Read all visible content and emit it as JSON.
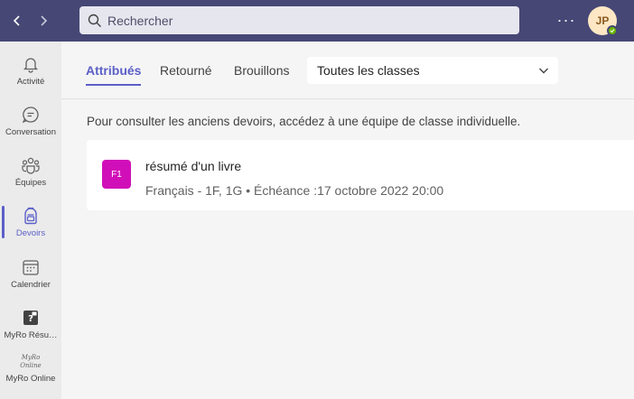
{
  "header": {
    "search_placeholder": "Rechercher",
    "more_label": "···",
    "avatar_initials": "JP",
    "presence": "available"
  },
  "rail": {
    "items": [
      {
        "label": "Activité",
        "icon": "bell-icon"
      },
      {
        "label": "Conversation",
        "icon": "chat-icon"
      },
      {
        "label": "Équipes",
        "icon": "teams-icon"
      },
      {
        "label": "Devoirs",
        "icon": "backpack-icon",
        "active": true
      },
      {
        "label": "Calendrier",
        "icon": "calendar-icon"
      },
      {
        "label": "MyRo Résu…",
        "icon": "myro-app-icon"
      },
      {
        "label": "MyRo Online",
        "icon": "myro-online-logo",
        "logo_text": "MyRo Online"
      }
    ]
  },
  "tabs": [
    {
      "label": "Attribués",
      "active": true
    },
    {
      "label": "Retourné"
    },
    {
      "label": "Brouillons"
    }
  ],
  "class_filter": {
    "selected": "Toutes les classes"
  },
  "info_text": "Pour consulter les anciens devoirs, accédez à une équipe de classe individuelle.",
  "assignments": [
    {
      "badge": "F1",
      "badge_color": "#d10fb8",
      "title": "résumé d'un livre",
      "subtitle": "Français - 1F, 1G • Échéance :17 octobre 2022 20:00"
    }
  ],
  "colors": {
    "accent": "#5b5fc7",
    "header_bg": "#464775"
  }
}
